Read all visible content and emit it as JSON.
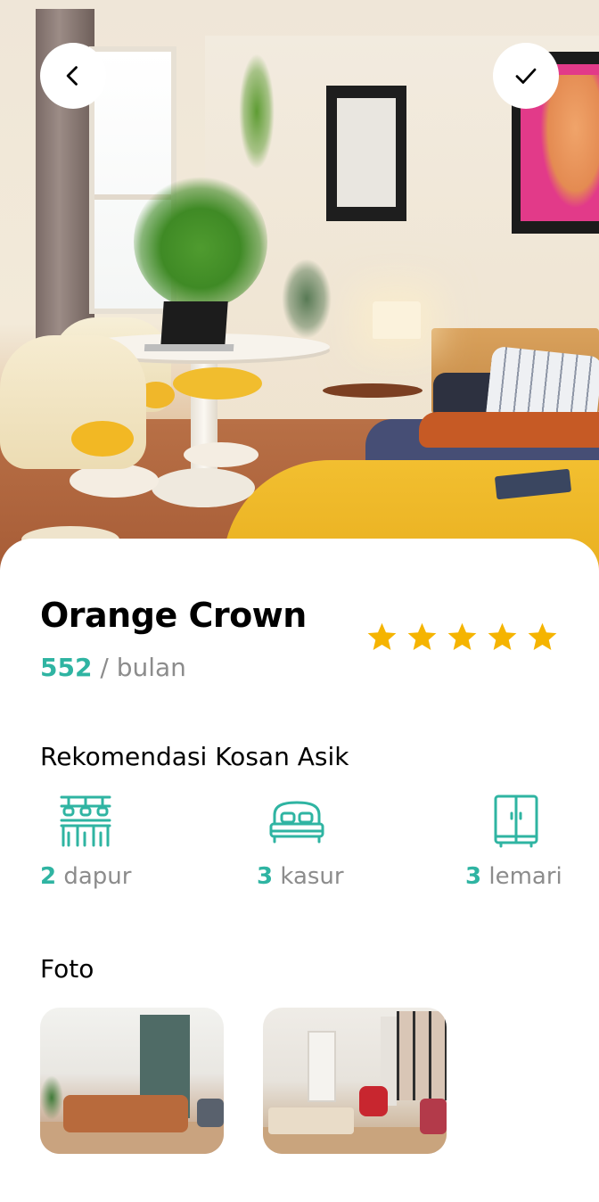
{
  "header": {
    "back_icon": "chevron-left-icon",
    "confirm_icon": "check-icon"
  },
  "hero": {
    "image": "bedroom-photo"
  },
  "property": {
    "name": "Orange Crown",
    "price_amount": "552",
    "price_unit": " / bulan",
    "rating": 5,
    "star_color": "#f5b400",
    "accent_color": "#2fb4a2"
  },
  "recommendation": {
    "title": "Rekomendasi Kosan Asik",
    "facilities": [
      {
        "icon": "kitchen-icon",
        "count": "2",
        "label": " dapur"
      },
      {
        "icon": "bed-icon",
        "count": "3",
        "label": " kasur"
      },
      {
        "icon": "wardrobe-icon",
        "count": "3",
        "label": " lemari"
      }
    ]
  },
  "photos": {
    "title": "Foto",
    "items": [
      {
        "icon": "living-room-photo"
      },
      {
        "icon": "studio-room-photo"
      }
    ]
  }
}
